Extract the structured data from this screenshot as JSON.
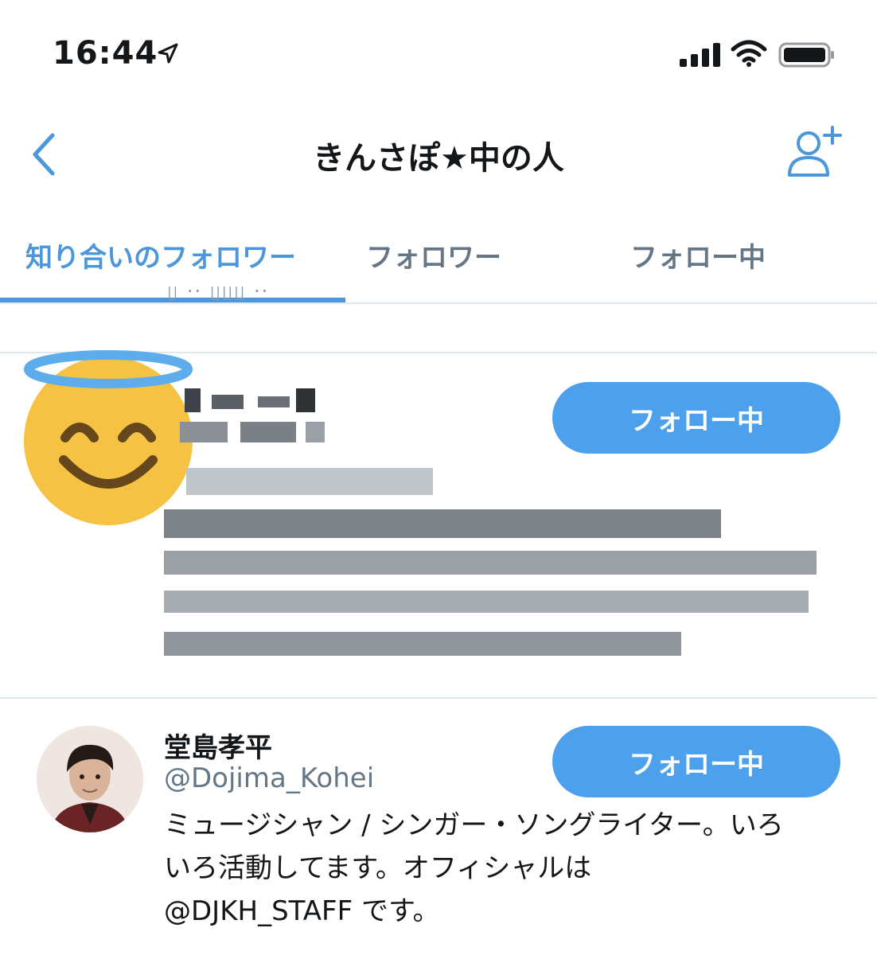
{
  "status_bar": {
    "time": "16:44"
  },
  "nav": {
    "title": "きんさぽ★中の人"
  },
  "tabs": [
    {
      "label": "知り合いのフォロワー",
      "active": true
    },
    {
      "label": "フォロワー",
      "active": false
    },
    {
      "label": "フォロー中",
      "active": false
    }
  ],
  "colors": {
    "accent": "#4c97d9",
    "button": "#4da1ec",
    "secondary_text": "#657786"
  },
  "users": [
    {
      "avatar": "smiling-face-with-halo-emoji",
      "button_label": "フォロー中"
    },
    {
      "name": "堂島孝平",
      "handle": "@Dojima_Kohei",
      "bio_lines": [
        "ミュージシャン / シンガー・ソングライター。いろ",
        "いろ活動してます。オフィシャルは",
        "@DJKH_STAFF です。"
      ],
      "button_label": "フォロー中"
    }
  ]
}
